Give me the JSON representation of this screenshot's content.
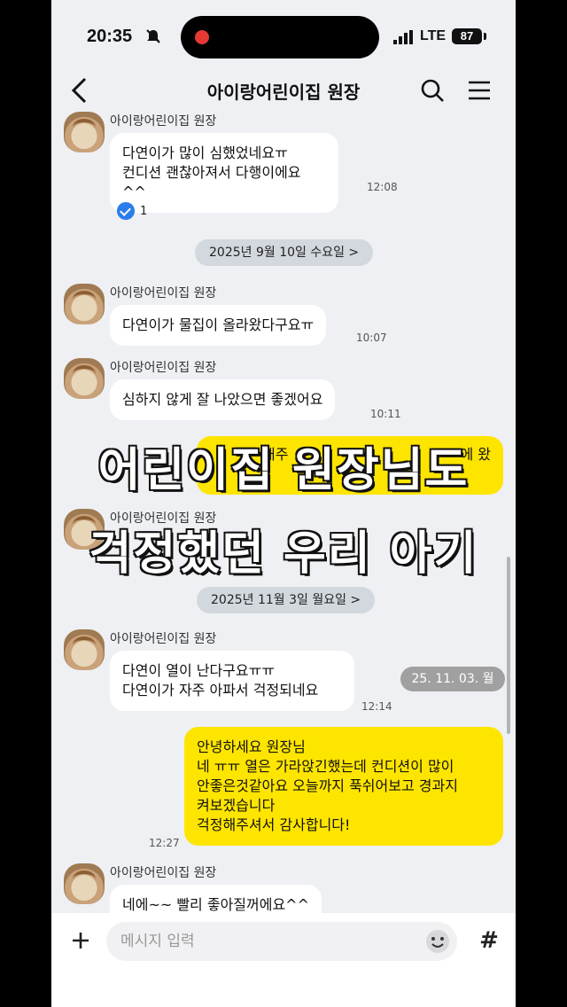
{
  "status_bar": {
    "time": "20:35",
    "network": "LTE",
    "battery": "87"
  },
  "header": {
    "title": "아이랑어린이집 원장"
  },
  "messages": [
    {
      "sender": "아이랑어린이집 원장",
      "text": "다연이가 많이 심했었네요ㅠ\n컨디션 괜찮아져서 다행이에요 ^^",
      "time": "12:08",
      "read_count": "1"
    },
    {
      "date": "2025년 9월 10일 수요일 >"
    },
    {
      "sender": "아이랑어린이집 원장",
      "text": "다연이가 물집이 올라왔다구요ㅠ",
      "time": "10:07"
    },
    {
      "sender": "아이랑어린이집 원장",
      "text": "심하지  않게 잘 나았으면 좋겠어요",
      "time": "10:11"
    },
    {
      "mine": true,
      "partial_text_1": "해주",
      "partial_text_2": "에 왔"
    },
    {
      "sender": "아이랑어린이집 원장"
    },
    {
      "date": "2025년 11월 3일 월요일 >"
    },
    {
      "sender": "아이랑어린이집 원장",
      "text": "다연이 열이 난다구요ㅠㅠ\n다연이가 자주 아파서 걱정되네요",
      "time": "12:14"
    },
    {
      "mine": true,
      "text": "안녕하세요 원장님\n네 ㅠㅠ 열은 가라앉긴했는데 컨디션이 많이\n안좋은것같아요 오늘까지 푹쉬어보고 경과지\n켜보겠습니다\n걱정해주셔서 감사합니다!",
      "time": "12:27"
    },
    {
      "sender": "아이랑어린이집 원장",
      "text": "네에~~ 빨리 좋아질꺼에요^^"
    }
  ],
  "floating_date": "25. 11. 03. 월",
  "caption": {
    "line1": "어린이집 원장님도",
    "line2": "걱정했던 우리 아기"
  },
  "input": {
    "placeholder": "메시지 입력"
  },
  "icons": [
    "back-icon",
    "search-icon",
    "menu-icon",
    "plus-icon",
    "emoji-icon",
    "hash-icon",
    "bell-mute-icon",
    "signal-icon",
    "battery-icon"
  ],
  "colors": {
    "my_bubble": "#fee500",
    "their_bubble": "#ffffff",
    "read_badge": "#2b7de9"
  }
}
